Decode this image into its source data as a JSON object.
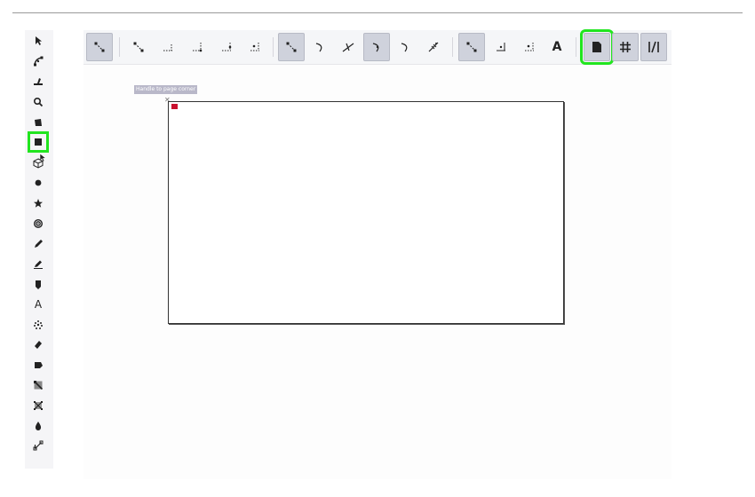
{
  "canvas": {
    "handle_tooltip": "Handle to page corner"
  },
  "left_tools": [
    {
      "name": "selector-tool",
      "icon": "pointer-arrow-icon"
    },
    {
      "name": "node-tool",
      "icon": "node-edit-icon"
    },
    {
      "name": "tweak-tool",
      "icon": "tweak-icon"
    },
    {
      "name": "zoom-tool",
      "icon": "magnifier-icon"
    },
    {
      "name": "measure-tool",
      "icon": "measure-icon"
    },
    {
      "name": "rectangle-tool",
      "icon": "rectangle-icon",
      "highlighted": true
    },
    {
      "name": "3d-box-tool",
      "icon": "3d-box-icon"
    },
    {
      "name": "ellipse-tool",
      "icon": "ellipse-icon"
    },
    {
      "name": "star-tool",
      "icon": "star-icon"
    },
    {
      "name": "spiral-tool",
      "icon": "spiral-icon"
    },
    {
      "name": "pencil-tool",
      "icon": "pencil-icon"
    },
    {
      "name": "pen-tool",
      "icon": "pen-icon"
    },
    {
      "name": "calligraphy-tool",
      "icon": "calligraphy-icon"
    },
    {
      "name": "text-tool",
      "icon": "text-A-icon",
      "glyph": "A"
    },
    {
      "name": "spray-tool",
      "icon": "spray-icon"
    },
    {
      "name": "eraser-tool",
      "icon": "eraser-icon"
    },
    {
      "name": "paint-bucket-tool",
      "icon": "bucket-icon"
    },
    {
      "name": "gradient-tool",
      "icon": "gradient-icon"
    },
    {
      "name": "mesh-tool",
      "icon": "mesh-icon"
    },
    {
      "name": "dropper-tool",
      "icon": "dropper-icon"
    },
    {
      "name": "connector-tool",
      "icon": "connector-icon"
    }
  ],
  "snap_toolbar": {
    "text_snap_glyph": "A",
    "page_snap_active": true
  }
}
